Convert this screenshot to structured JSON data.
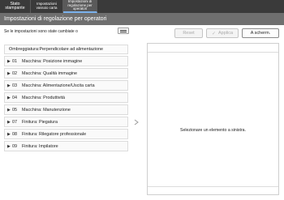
{
  "tabs": [
    {
      "label": "Stato stampante"
    },
    {
      "label": "Impostazioni vassoio carta"
    },
    {
      "label": "Impostazioni di regolazione per operatori"
    }
  ],
  "title": "Impostazioni di regolazione per operatori",
  "subtitle": "Se le impostazioni sono state cambiate o",
  "buttons": {
    "reset": "Reset",
    "apply": "Applica",
    "full_screen": "A scherm."
  },
  "list": {
    "header": "Ombreggiatura:Perpendicolare ad alimentazione",
    "items": [
      {
        "num": "01",
        "label": "Macchina: Posizione immagine"
      },
      {
        "num": "02",
        "label": "Macchina: Qualità immagine"
      },
      {
        "num": "03",
        "label": "Macchina: Alimentazione/Uscita carta"
      },
      {
        "num": "04",
        "label": "Macchina: Produttività"
      },
      {
        "num": "05",
        "label": "Macchina: Manutenzione"
      },
      {
        "num": "07",
        "label": "Finitura: Piegatura"
      },
      {
        "num": "08",
        "label": "Finitura: Rilegatore professionale"
      },
      {
        "num": "09",
        "label": "Finitura: Impilatore"
      }
    ]
  },
  "detail_message": "Selezionare un elemento a sinistra.",
  "colors": {
    "topbar": "#3a3a3a",
    "titlebar": "#6f6f6f",
    "active_tab_underline": "#7ab1ec"
  }
}
